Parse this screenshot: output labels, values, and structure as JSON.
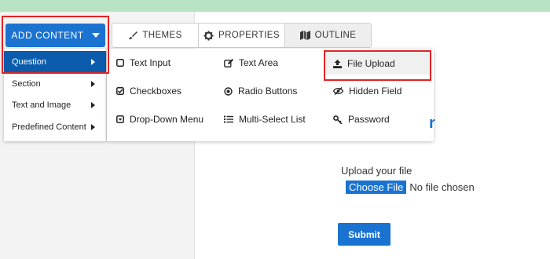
{
  "add_content": {
    "label": "ADD CONTENT"
  },
  "left_menu": {
    "items": [
      {
        "label": "Question",
        "active": true
      },
      {
        "label": "Section",
        "active": false
      },
      {
        "label": "Text and Image",
        "active": false
      },
      {
        "label": "Predefined Content",
        "active": false
      }
    ]
  },
  "tabs": [
    {
      "label": "THEMES",
      "icon": "brush-icon"
    },
    {
      "label": "PROPERTIES",
      "icon": "gear-icon"
    },
    {
      "label": "OUTLINE",
      "icon": "map-icon"
    }
  ],
  "question_types": [
    {
      "label": "Text Input",
      "icon": "square-icon"
    },
    {
      "label": "Text Area",
      "icon": "edit-icon"
    },
    {
      "label": "File Upload",
      "icon": "upload-icon",
      "selected": true
    },
    {
      "label": "Checkboxes",
      "icon": "checkbox-icon"
    },
    {
      "label": "Radio Buttons",
      "icon": "radio-icon"
    },
    {
      "label": "Hidden Field",
      "icon": "eye-slash-icon"
    },
    {
      "label": "Drop-Down Menu",
      "icon": "dropdown-icon"
    },
    {
      "label": "Multi-Select List",
      "icon": "list-icon"
    },
    {
      "label": "Password",
      "icon": "key-icon"
    }
  ],
  "preview": {
    "heading_fragment": "r",
    "upload_label": "Upload your file",
    "choose_file": "Choose File",
    "no_file": "No file chosen",
    "submit": "Submit"
  },
  "colors": {
    "accent": "#1a73d0",
    "active_menu": "#0b5cad",
    "highlight": "#e02424",
    "topbar": "#b8e2c4"
  }
}
